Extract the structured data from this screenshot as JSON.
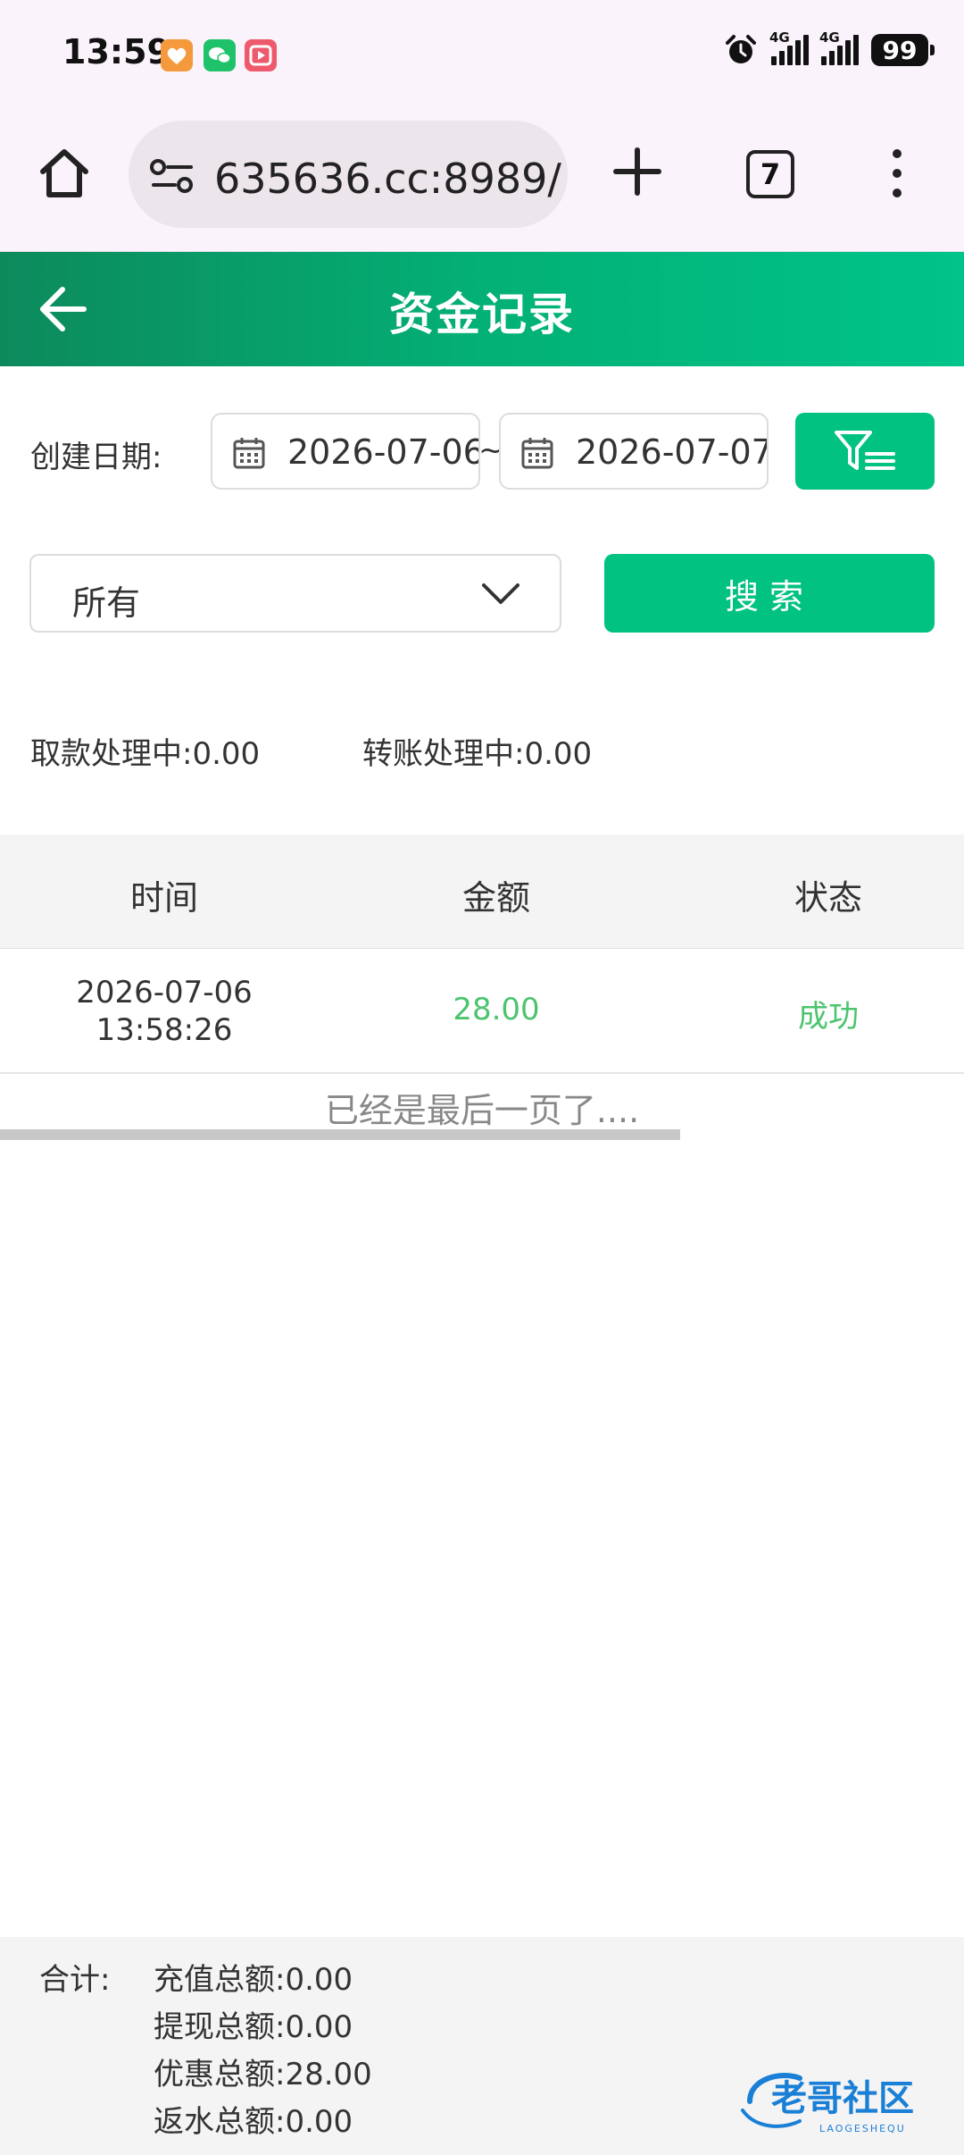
{
  "status_bar": {
    "time": "13:59",
    "network1": "4G",
    "network2": "4G",
    "battery": "99",
    "app_icons": [
      "health-app-icon",
      "wechat-icon",
      "video-app-icon"
    ]
  },
  "browser": {
    "url": "635636.cc:8989/",
    "tab_count": "7"
  },
  "header": {
    "title": "资金记录"
  },
  "filters": {
    "date_label": "创建日期:",
    "start_date": "2026-07-06",
    "separator": "~",
    "end_date": "2026-07-07",
    "type_selected": "所有",
    "search_label": "搜索"
  },
  "pending": {
    "withdraw": "取款处理中:0.00",
    "transfer": "转账处理中:0.00"
  },
  "table": {
    "headers": [
      "时间",
      "金额",
      "状态"
    ],
    "rows": [
      {
        "date": "2026-07-06",
        "time": "13:58:26",
        "amount": "28.00",
        "status": "成功"
      }
    ],
    "end_text": "已经是最后一页了...."
  },
  "footer": {
    "label": "合计:",
    "lines": [
      "充值总额:0.00",
      "提现总额:0.00",
      "优惠总额:28.00",
      "返水总额:0.00"
    ]
  },
  "watermark": {
    "text": "老哥社区",
    "subtext": "LAOGESHEQU"
  },
  "colors": {
    "accent": "#02c281",
    "header_start": "#0d8a5c",
    "header_end": "#00c48a",
    "success": "#4cc46e"
  }
}
